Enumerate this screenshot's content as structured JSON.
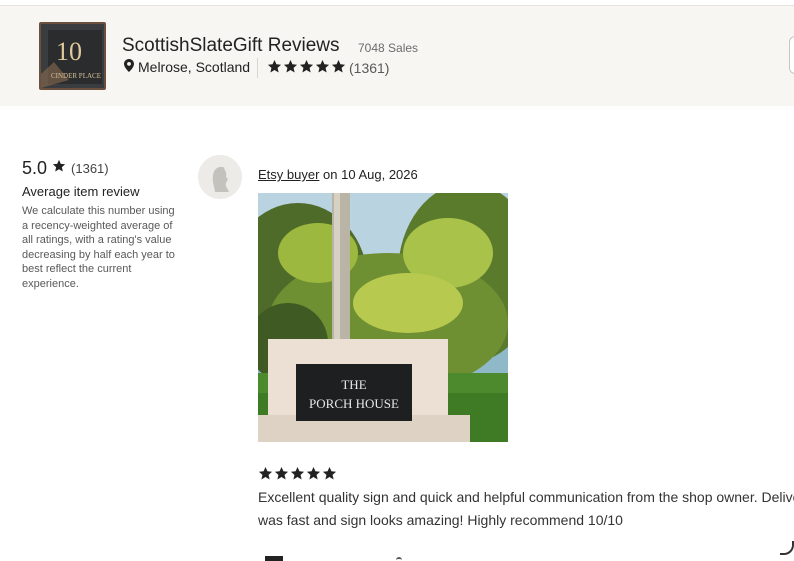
{
  "shop": {
    "name": "ScottishSlateGift Reviews",
    "sales": "7048 Sales",
    "location": "Melrose, Scotland",
    "rating_stars": 5,
    "rating_count": "(1361)",
    "thumb_number": "10",
    "thumb_text": "CINDER PLACE"
  },
  "summary": {
    "score": "5.0",
    "count": "(1361)",
    "title": "Average item review",
    "description": "We calculate this number using a recency-weighted average of all ratings, with a rating's value decreasing by half each year to best reflect the current experience."
  },
  "review": {
    "buyer": "Etsy buyer",
    "date_prefix": " on ",
    "date": "10 Aug, 2026",
    "stars": 5,
    "photo_sign_line1": "THE",
    "photo_sign_line2": "PORCH HOUSE",
    "text": "Excellent quality sign and quick and helpful communication from the shop owner. Delivery was fast and sign looks amazing! Highly recommend 10/10"
  },
  "colors": {
    "header_bg": "#f7f6f3",
    "star": "#222222",
    "text_muted": "#595959"
  },
  "icons": {
    "location": "map-pin-icon",
    "star": "star-icon",
    "avatar": "user-silhouette-icon"
  }
}
